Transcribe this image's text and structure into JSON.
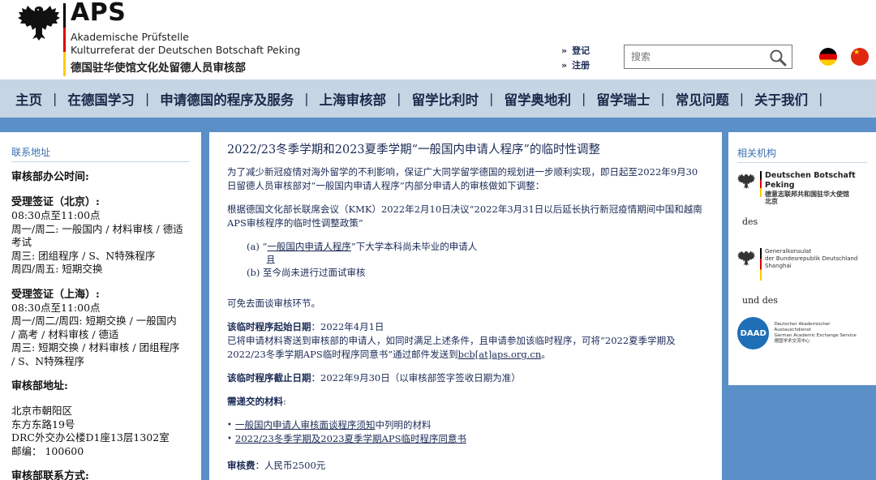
{
  "header": {
    "logo_title": "APS",
    "logo_line1": "Akademische Prüfstelle",
    "logo_line2": "Kulturreferat der Deutschen Botschaft Peking",
    "logo_line3": "德国驻华使馆文化处留德人员审核部",
    "login": "登记",
    "register": "注册",
    "search_placeholder": "搜索"
  },
  "nav": [
    "主页",
    "在德国学习",
    "申请德国的程序及服务",
    "上海审核部",
    "留学比利时",
    "留学奥地利",
    "留学瑞士",
    "常见问题",
    "关于我们"
  ],
  "left": {
    "heading": "联系地址",
    "hours_label": "审核部办公时间:",
    "bj_label": "受理签证（北京）:",
    "bj_time": "08:30点至11:00点",
    "bj_l1": "周一/周二: 一般国内 / 材料审核 / 德适",
    "bj_l2": "考试",
    "bj_l3": "周三: 团组程序 / S、N特殊程序",
    "bj_l4": "周四/周五: 短期交换",
    "sh_label": "受理签证（上海）:",
    "sh_time": "08:30点至11:00点",
    "sh_l1": "周一/周二/周四: 短期交换 / 一般国内",
    "sh_l2": "/ 高考 / 材料审核 / 德适",
    "sh_l3": "周三: 短期交换 / 材料审核 / 团组程序",
    "sh_l4": "/ S、N特殊程序",
    "addr_label": "审核部地址:",
    "addr_l1": "北京市朝阳区",
    "addr_l2": "东方东路19号",
    "addr_l3": "DRC外交办公楼D1座13层1302室",
    "addr_l4": "邮编： 100600",
    "contact_label": "审核部联系方式:"
  },
  "main": {
    "title": "2022/23冬季学期和2023夏季学期“一般国内申请人程序”的临时性调整",
    "p1": "为了减少新冠疫情对海外留学的不利影响，保证广大同学留学德国的规划进一步顺利实现，即日起至2022年9月30日留德人员审核部对“一般国内申请人程序”内部分申请人的审核做如下调整：",
    "p2": "根据德国文化部长联席会议（KMK）2022年2月10日决议“2022年3月31日以后延长执行新冠疫情期间中国和越南APS审核程序的临时性调整政策”",
    "opt_a_prefix": "(a) “",
    "opt_a_link": "一般国内申请人程序",
    "opt_a_suffix": "”下大学本科尚未毕业的申请人",
    "opt_and": "且",
    "opt_b": "(b) 至今尚未进行过面试审核",
    "p3": "可免去面谈审核环节。",
    "start_label": "该临时程序起始日期",
    "start_value": "：2022年4月1日",
    "p4a": "已将申请材料寄送到审核部的申请人，如同时满足上述条件，且申请参加该临时程序，可将“2022夏季学期及2022/23冬季学期APS临时程序同意书”通过邮件发送到",
    "p4_email": "bcb[at]aps.org.cn",
    "p4b": "。",
    "end_label": "该临时程序截止日期",
    "end_value": "：2022年9月30日（以审核部签字签收日期为准）",
    "materials_label": "需递交的材料",
    "materials_colon": ":",
    "li1_link": "一般国内申请人审核面谈程序须知",
    "li1_suffix": "中列明的材料",
    "li2_link": "2022/23冬季学期及2023夏季学期APS临时程序同意书",
    "fee_label": "审核费",
    "fee_value": "：人民币2500元"
  },
  "right": {
    "heading": "相关机构",
    "org1_t1": "Deutschen Botschaft Peking",
    "org1_t2": "德意志联邦共和国驻华大使馆",
    "org1_t3": "北京",
    "des": "des",
    "org2_t1": "Generalkonsulat",
    "org2_t2": "der Bundesrepublik Deutschland",
    "org2_t3": "Shanghai",
    "und_des": "und des",
    "daad_circle": "DAAD",
    "daad_t1": "Deutscher Akademischer Austauschdienst",
    "daad_t2": "German Academic Exchange Service",
    "daad_t3": "德国学术交流中心"
  },
  "colors": {
    "nav_bg": "#c5d5e3",
    "band": "#5b8fc8",
    "heading_blue": "#3a70b0",
    "text_navy": "#1a2a55"
  }
}
